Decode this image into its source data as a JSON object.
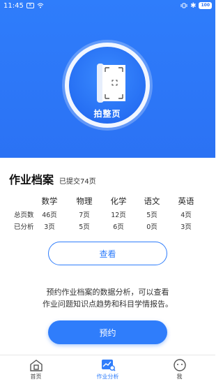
{
  "status_bar": {
    "time": "11:45",
    "battery": "100"
  },
  "hero": {
    "shoot_label": "拍整页"
  },
  "archive": {
    "title": "作业档案",
    "submitted": "已提交74页",
    "subjects": [
      "数学",
      "物理",
      "化学",
      "语文",
      "英语"
    ],
    "rows": [
      {
        "label": "总页数",
        "values": [
          "46页",
          "7页",
          "12页",
          "5页",
          "4页"
        ]
      },
      {
        "label": "已分析",
        "values": [
          "3页",
          "5页",
          "6页",
          "0页",
          "3页"
        ]
      }
    ],
    "view_button": "查看",
    "description_line1": "预约作业档案的数据分析，可以查看",
    "description_line2": "作业问题知识点趋势和科目学情报告。",
    "book_button": "预约"
  },
  "tabbar": {
    "items": [
      {
        "label": "首页",
        "icon": "home-icon"
      },
      {
        "label": "作业分析",
        "icon": "analysis-icon"
      },
      {
        "label": "我",
        "icon": "profile-icon"
      }
    ]
  },
  "colors": {
    "primary": "#2f7dfb"
  }
}
